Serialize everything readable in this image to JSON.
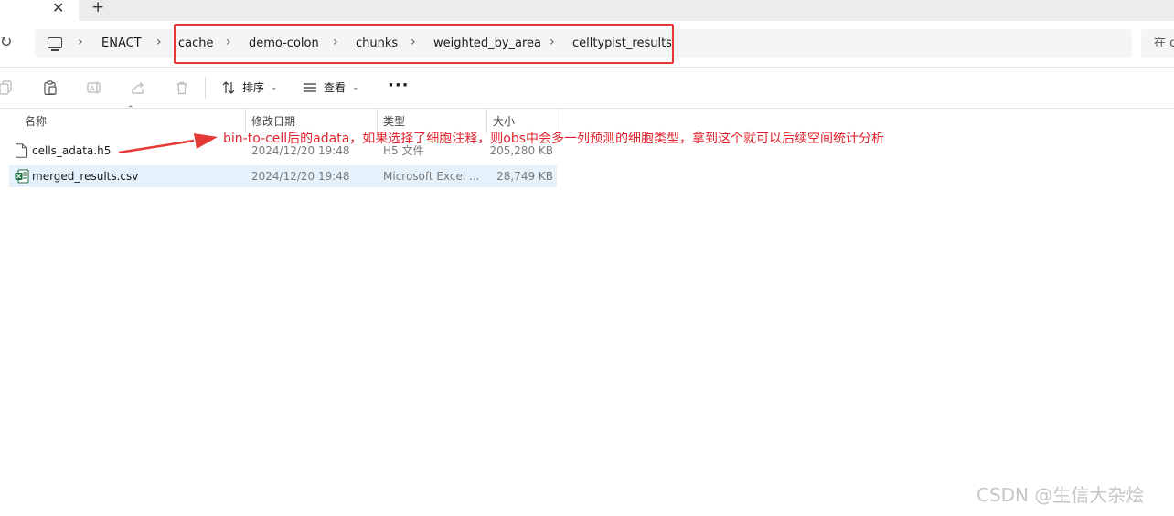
{
  "tabs": {
    "close_icon": "✕",
    "new_tab_icon": "+"
  },
  "address_bar": {
    "refresh_icon": "↻",
    "breadcrumbs": [
      "ENACT",
      "cache",
      "demo-colon",
      "chunks",
      "weighted_by_area",
      "celltypist_results"
    ],
    "separator_icon": "chevron-right-icon"
  },
  "search": {
    "placeholder": "在 c"
  },
  "toolbar": {
    "sort_label": "排序",
    "view_label": "查看",
    "more_label": "···"
  },
  "columns": {
    "name": "名称",
    "modified": "修改日期",
    "type": "类型",
    "size": "大小"
  },
  "files": [
    {
      "name": "cells_adata.h5",
      "modified": "2024/12/20 19:48",
      "type": "H5 文件",
      "size": "205,280 KB",
      "icon": "file-icon",
      "selected": false
    },
    {
      "name": "merged_results.csv",
      "modified": "2024/12/20 19:48",
      "type": "Microsoft Excel ...",
      "size": "28,749 KB",
      "icon": "excel-icon",
      "selected": true
    }
  ],
  "annotation": {
    "text": "bin-to-cell后的adata，如果选择了细胞注释，则obs中会多一列预测的细胞类型，拿到这个就可以后续空间统计分析",
    "color": "#e0242d"
  },
  "watermark": "CSDN @生信大杂烩",
  "colors": {
    "highlight_box": "#e53935",
    "selected_row": "#e5f1fb",
    "excel_green": "#1d6f42"
  }
}
